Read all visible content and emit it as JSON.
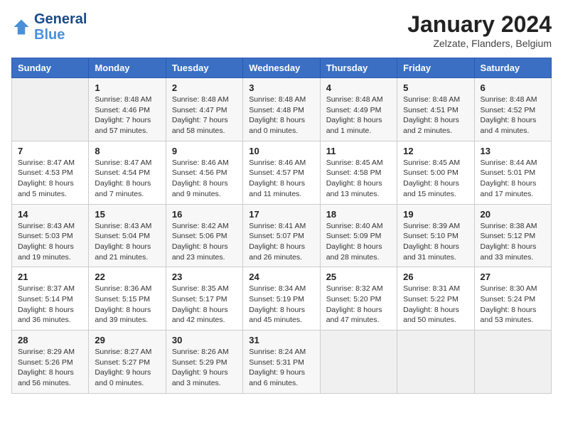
{
  "header": {
    "logo_general": "General",
    "logo_blue": "Blue",
    "title": "January 2024",
    "location": "Zelzate, Flanders, Belgium"
  },
  "weekdays": [
    "Sunday",
    "Monday",
    "Tuesday",
    "Wednesday",
    "Thursday",
    "Friday",
    "Saturday"
  ],
  "weeks": [
    [
      {
        "day": "",
        "sunrise": "",
        "sunset": "",
        "daylight": ""
      },
      {
        "day": "1",
        "sunrise": "Sunrise: 8:48 AM",
        "sunset": "Sunset: 4:46 PM",
        "daylight": "Daylight: 7 hours and 57 minutes."
      },
      {
        "day": "2",
        "sunrise": "Sunrise: 8:48 AM",
        "sunset": "Sunset: 4:47 PM",
        "daylight": "Daylight: 7 hours and 58 minutes."
      },
      {
        "day": "3",
        "sunrise": "Sunrise: 8:48 AM",
        "sunset": "Sunset: 4:48 PM",
        "daylight": "Daylight: 8 hours and 0 minutes."
      },
      {
        "day": "4",
        "sunrise": "Sunrise: 8:48 AM",
        "sunset": "Sunset: 4:49 PM",
        "daylight": "Daylight: 8 hours and 1 minute."
      },
      {
        "day": "5",
        "sunrise": "Sunrise: 8:48 AM",
        "sunset": "Sunset: 4:51 PM",
        "daylight": "Daylight: 8 hours and 2 minutes."
      },
      {
        "day": "6",
        "sunrise": "Sunrise: 8:48 AM",
        "sunset": "Sunset: 4:52 PM",
        "daylight": "Daylight: 8 hours and 4 minutes."
      }
    ],
    [
      {
        "day": "7",
        "sunrise": "Sunrise: 8:47 AM",
        "sunset": "Sunset: 4:53 PM",
        "daylight": "Daylight: 8 hours and 5 minutes."
      },
      {
        "day": "8",
        "sunrise": "Sunrise: 8:47 AM",
        "sunset": "Sunset: 4:54 PM",
        "daylight": "Daylight: 8 hours and 7 minutes."
      },
      {
        "day": "9",
        "sunrise": "Sunrise: 8:46 AM",
        "sunset": "Sunset: 4:56 PM",
        "daylight": "Daylight: 8 hours and 9 minutes."
      },
      {
        "day": "10",
        "sunrise": "Sunrise: 8:46 AM",
        "sunset": "Sunset: 4:57 PM",
        "daylight": "Daylight: 8 hours and 11 minutes."
      },
      {
        "day": "11",
        "sunrise": "Sunrise: 8:45 AM",
        "sunset": "Sunset: 4:58 PM",
        "daylight": "Daylight: 8 hours and 13 minutes."
      },
      {
        "day": "12",
        "sunrise": "Sunrise: 8:45 AM",
        "sunset": "Sunset: 5:00 PM",
        "daylight": "Daylight: 8 hours and 15 minutes."
      },
      {
        "day": "13",
        "sunrise": "Sunrise: 8:44 AM",
        "sunset": "Sunset: 5:01 PM",
        "daylight": "Daylight: 8 hours and 17 minutes."
      }
    ],
    [
      {
        "day": "14",
        "sunrise": "Sunrise: 8:43 AM",
        "sunset": "Sunset: 5:03 PM",
        "daylight": "Daylight: 8 hours and 19 minutes."
      },
      {
        "day": "15",
        "sunrise": "Sunrise: 8:43 AM",
        "sunset": "Sunset: 5:04 PM",
        "daylight": "Daylight: 8 hours and 21 minutes."
      },
      {
        "day": "16",
        "sunrise": "Sunrise: 8:42 AM",
        "sunset": "Sunset: 5:06 PM",
        "daylight": "Daylight: 8 hours and 23 minutes."
      },
      {
        "day": "17",
        "sunrise": "Sunrise: 8:41 AM",
        "sunset": "Sunset: 5:07 PM",
        "daylight": "Daylight: 8 hours and 26 minutes."
      },
      {
        "day": "18",
        "sunrise": "Sunrise: 8:40 AM",
        "sunset": "Sunset: 5:09 PM",
        "daylight": "Daylight: 8 hours and 28 minutes."
      },
      {
        "day": "19",
        "sunrise": "Sunrise: 8:39 AM",
        "sunset": "Sunset: 5:10 PM",
        "daylight": "Daylight: 8 hours and 31 minutes."
      },
      {
        "day": "20",
        "sunrise": "Sunrise: 8:38 AM",
        "sunset": "Sunset: 5:12 PM",
        "daylight": "Daylight: 8 hours and 33 minutes."
      }
    ],
    [
      {
        "day": "21",
        "sunrise": "Sunrise: 8:37 AM",
        "sunset": "Sunset: 5:14 PM",
        "daylight": "Daylight: 8 hours and 36 minutes."
      },
      {
        "day": "22",
        "sunrise": "Sunrise: 8:36 AM",
        "sunset": "Sunset: 5:15 PM",
        "daylight": "Daylight: 8 hours and 39 minutes."
      },
      {
        "day": "23",
        "sunrise": "Sunrise: 8:35 AM",
        "sunset": "Sunset: 5:17 PM",
        "daylight": "Daylight: 8 hours and 42 minutes."
      },
      {
        "day": "24",
        "sunrise": "Sunrise: 8:34 AM",
        "sunset": "Sunset: 5:19 PM",
        "daylight": "Daylight: 8 hours and 45 minutes."
      },
      {
        "day": "25",
        "sunrise": "Sunrise: 8:32 AM",
        "sunset": "Sunset: 5:20 PM",
        "daylight": "Daylight: 8 hours and 47 minutes."
      },
      {
        "day": "26",
        "sunrise": "Sunrise: 8:31 AM",
        "sunset": "Sunset: 5:22 PM",
        "daylight": "Daylight: 8 hours and 50 minutes."
      },
      {
        "day": "27",
        "sunrise": "Sunrise: 8:30 AM",
        "sunset": "Sunset: 5:24 PM",
        "daylight": "Daylight: 8 hours and 53 minutes."
      }
    ],
    [
      {
        "day": "28",
        "sunrise": "Sunrise: 8:29 AM",
        "sunset": "Sunset: 5:26 PM",
        "daylight": "Daylight: 8 hours and 56 minutes."
      },
      {
        "day": "29",
        "sunrise": "Sunrise: 8:27 AM",
        "sunset": "Sunset: 5:27 PM",
        "daylight": "Daylight: 9 hours and 0 minutes."
      },
      {
        "day": "30",
        "sunrise": "Sunrise: 8:26 AM",
        "sunset": "Sunset: 5:29 PM",
        "daylight": "Daylight: 9 hours and 3 minutes."
      },
      {
        "day": "31",
        "sunrise": "Sunrise: 8:24 AM",
        "sunset": "Sunset: 5:31 PM",
        "daylight": "Daylight: 9 hours and 6 minutes."
      },
      {
        "day": "",
        "sunrise": "",
        "sunset": "",
        "daylight": ""
      },
      {
        "day": "",
        "sunrise": "",
        "sunset": "",
        "daylight": ""
      },
      {
        "day": "",
        "sunrise": "",
        "sunset": "",
        "daylight": ""
      }
    ]
  ]
}
